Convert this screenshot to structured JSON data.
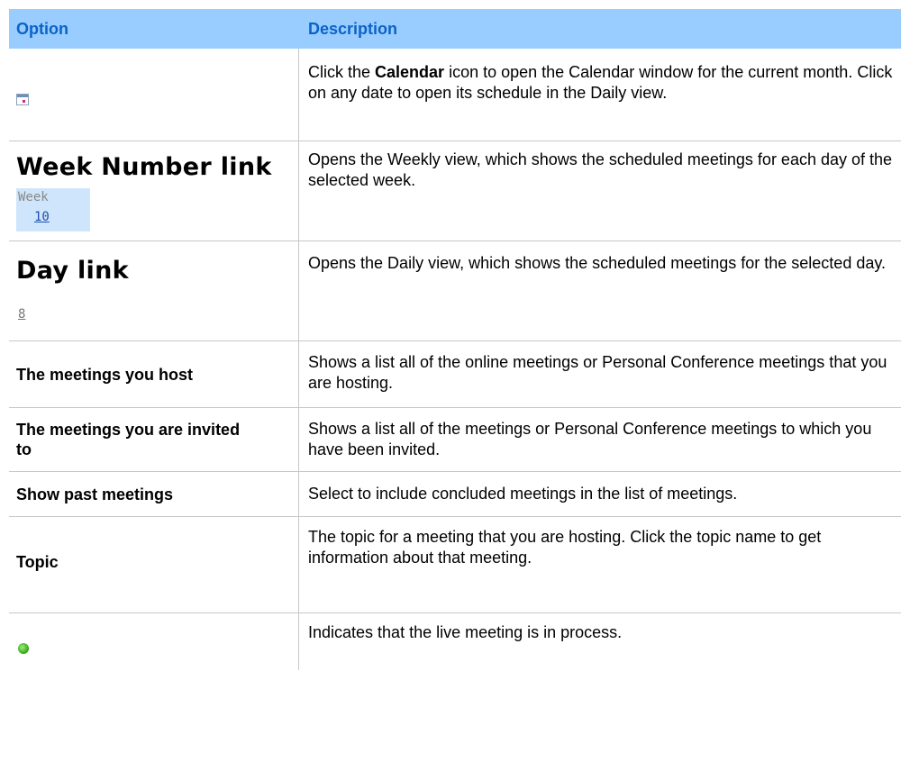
{
  "header": {
    "option": "Option",
    "description": "Description"
  },
  "rows": [
    {
      "option_icon": "calendar-icon",
      "description_pre": "Click the ",
      "description_bold": "Calendar",
      "description_post": " icon to open the Calendar window for the current month. Click on any date to open its schedule in the Daily view."
    },
    {
      "option": "Week Number link",
      "sample_label": "Week",
      "sample_value": "10",
      "description": "Opens the Weekly view, which shows the scheduled meetings for each day of the selected week."
    },
    {
      "option": "Day link",
      "sample_value": "8",
      "description": "Opens the Daily view, which shows the scheduled meetings for the selected day."
    },
    {
      "option": "The meetings you host",
      "description": "Shows a list all of the online meetings or Personal Conference meetings that you are hosting."
    },
    {
      "option": "The meetings you are invited to",
      "description": "Shows a list all of the meetings or Personal Conference meetings to which you have been invited."
    },
    {
      "option": "Show past meetings",
      "description": "Select to include concluded meetings in the list of meetings."
    },
    {
      "option": "Topic",
      "description": "The topic for a meeting that you are hosting. Click the topic name to get information about that meeting."
    },
    {
      "option_icon": "live-meeting-icon",
      "description": "Indicates that the live meeting is in process."
    }
  ],
  "colors": {
    "header_bg": "#99ccff",
    "header_text": "#0b63c7",
    "live_green": "#2ea312"
  }
}
